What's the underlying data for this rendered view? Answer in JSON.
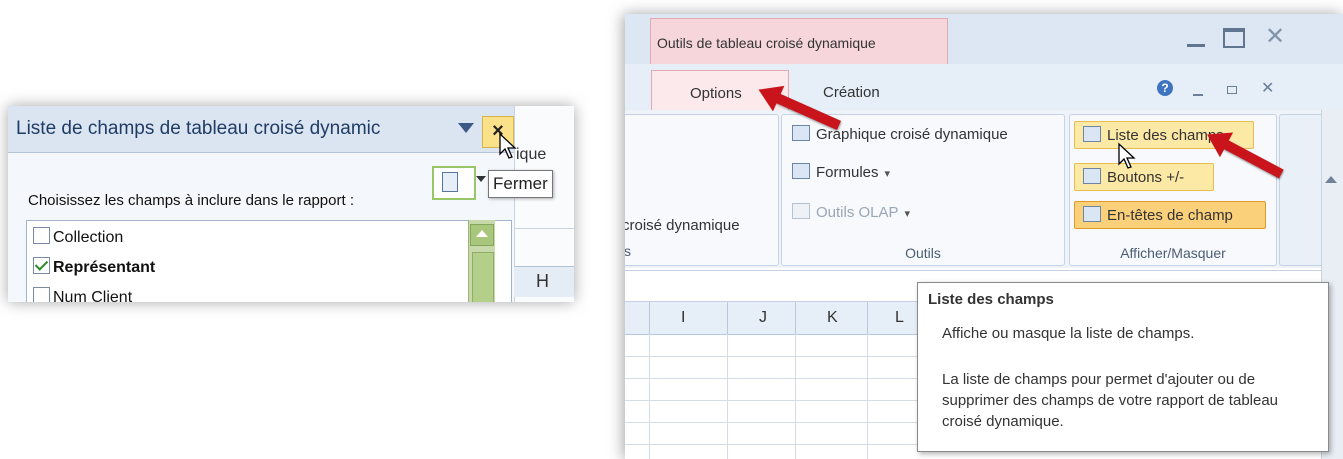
{
  "left_panel": {
    "title": "Liste de champs de tableau croisé dynamic",
    "close_label": "×",
    "partial_right_text": "ique",
    "tooltip": "Fermer",
    "instruction": "Choisissez les champs à inclure dans le rapport :",
    "fields": [
      {
        "label": "Collection",
        "checked": false,
        "bold": false
      },
      {
        "label": "Représentant",
        "checked": true,
        "bold": true
      },
      {
        "label": "Num Client",
        "checked": false,
        "bold": false
      }
    ],
    "column_header": "H"
  },
  "right_window": {
    "context_tab": "Outils de tableau croisé dynamique",
    "tabs": [
      "Options",
      "Création"
    ],
    "groups": {
      "left_fragment_label": "croisé dynamique",
      "left_fragment_section": "s",
      "outils": {
        "label": "Outils",
        "buttons": [
          {
            "label": "Graphique croisé dynamique",
            "disabled": false
          },
          {
            "label": "Formules",
            "dropdown": "▾",
            "disabled": false
          },
          {
            "label": "Outils OLAP",
            "dropdown": "▾",
            "disabled": true
          }
        ]
      },
      "afficher_masquer": {
        "label": "Afficher/Masquer",
        "buttons": [
          {
            "label": "Liste des champs"
          },
          {
            "label": "Boutons +/-"
          },
          {
            "label": "En-têtes de champ"
          }
        ]
      }
    },
    "column_headers": [
      "I",
      "J",
      "K",
      "L"
    ],
    "tooltip": {
      "title": "Liste des champs",
      "line1": "Affiche ou masque la liste de champs.",
      "line2": "La liste de champs pour permet d'ajouter ou de supprimer des champs de votre rapport de tableau croisé dynamique."
    }
  },
  "colors": {
    "annotation_arrow": "#c8141a",
    "highlight": "#fde9a6",
    "context_tab": "#f6d6db"
  }
}
